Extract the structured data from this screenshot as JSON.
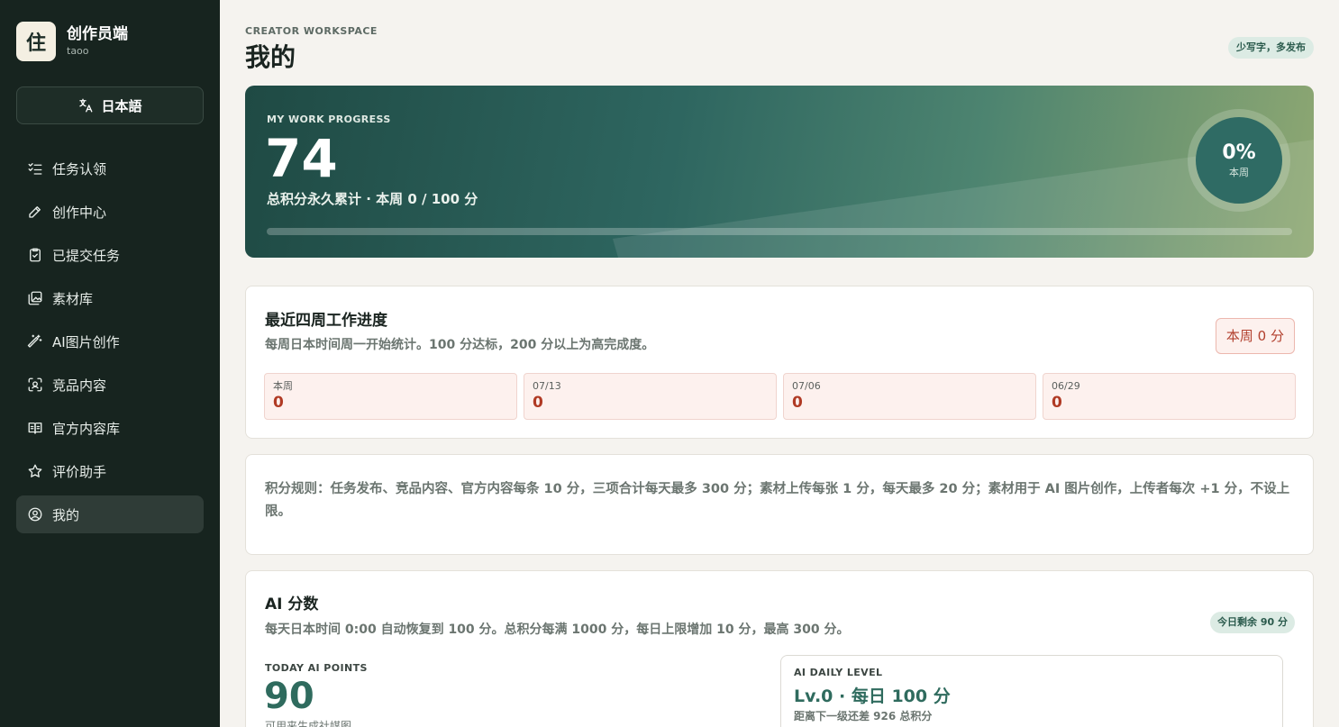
{
  "brand": {
    "logo_char": "住",
    "title": "创作员端",
    "user": "taoo"
  },
  "language_button": {
    "label": "日本語",
    "icon": "translate-icon"
  },
  "nav": [
    {
      "label": "任务认领",
      "icon": "checklist-icon",
      "active": false
    },
    {
      "label": "创作中心",
      "icon": "pencil-icon",
      "active": false
    },
    {
      "label": "已提交任务",
      "icon": "clipboard-check-icon",
      "active": false
    },
    {
      "label": "素材库",
      "icon": "images-icon",
      "active": false
    },
    {
      "label": "AI图片创作",
      "icon": "magic-wand-icon",
      "active": false
    },
    {
      "label": "竞品内容",
      "icon": "scan-face-icon",
      "active": false
    },
    {
      "label": "官方内容库",
      "icon": "book-open-icon",
      "active": false
    },
    {
      "label": "评价助手",
      "icon": "star-icon",
      "active": false
    },
    {
      "label": "我的",
      "icon": "user-circle-icon",
      "active": true
    }
  ],
  "header": {
    "eyebrow": "CREATOR WORKSPACE",
    "title": "我的",
    "tag": "少写字，多发布"
  },
  "hero": {
    "eyebrow": "MY WORK PROGRESS",
    "total": "74",
    "subtitle": "总积分永久累计 · 本周 0 / 100 分",
    "progress": 0,
    "ring_percent": "0%",
    "ring_label": "本周"
  },
  "weekly": {
    "title": "最近四周工作进度",
    "desc": "每周日本时间周一开始统计。100 分达标，200 分以上为高完成度。",
    "badge": "本周 0 分",
    "weeks": [
      {
        "label": "本周",
        "value": "0"
      },
      {
        "label": "07/13",
        "value": "0"
      },
      {
        "label": "07/06",
        "value": "0"
      },
      {
        "label": "06/29",
        "value": "0"
      }
    ]
  },
  "rules": {
    "text": "积分规则：任务发布、竞品内容、官方内容每条 10 分，三项合计每天最多 300 分；素材上传每张 1 分，每天最多 20 分；素材用于 AI 图片创作，上传者每次 +1 分，不设上限。"
  },
  "ai": {
    "title": "AI 分数",
    "desc": "每天日本时间 0:00 自动恢复到 100 分。总积分每满 1000 分，每日上限增加 10 分，最高 300 分。",
    "badge": "今日剩余 90 分",
    "today_eyebrow": "TODAY AI POINTS",
    "today_value": "90",
    "today_note": "可用来生成社媒图",
    "level_eyebrow": "AI DAILY LEVEL",
    "level_title": "Lv.0 · 每日 100 分",
    "level_sub": "距离下一级还差 926 总积分"
  }
}
